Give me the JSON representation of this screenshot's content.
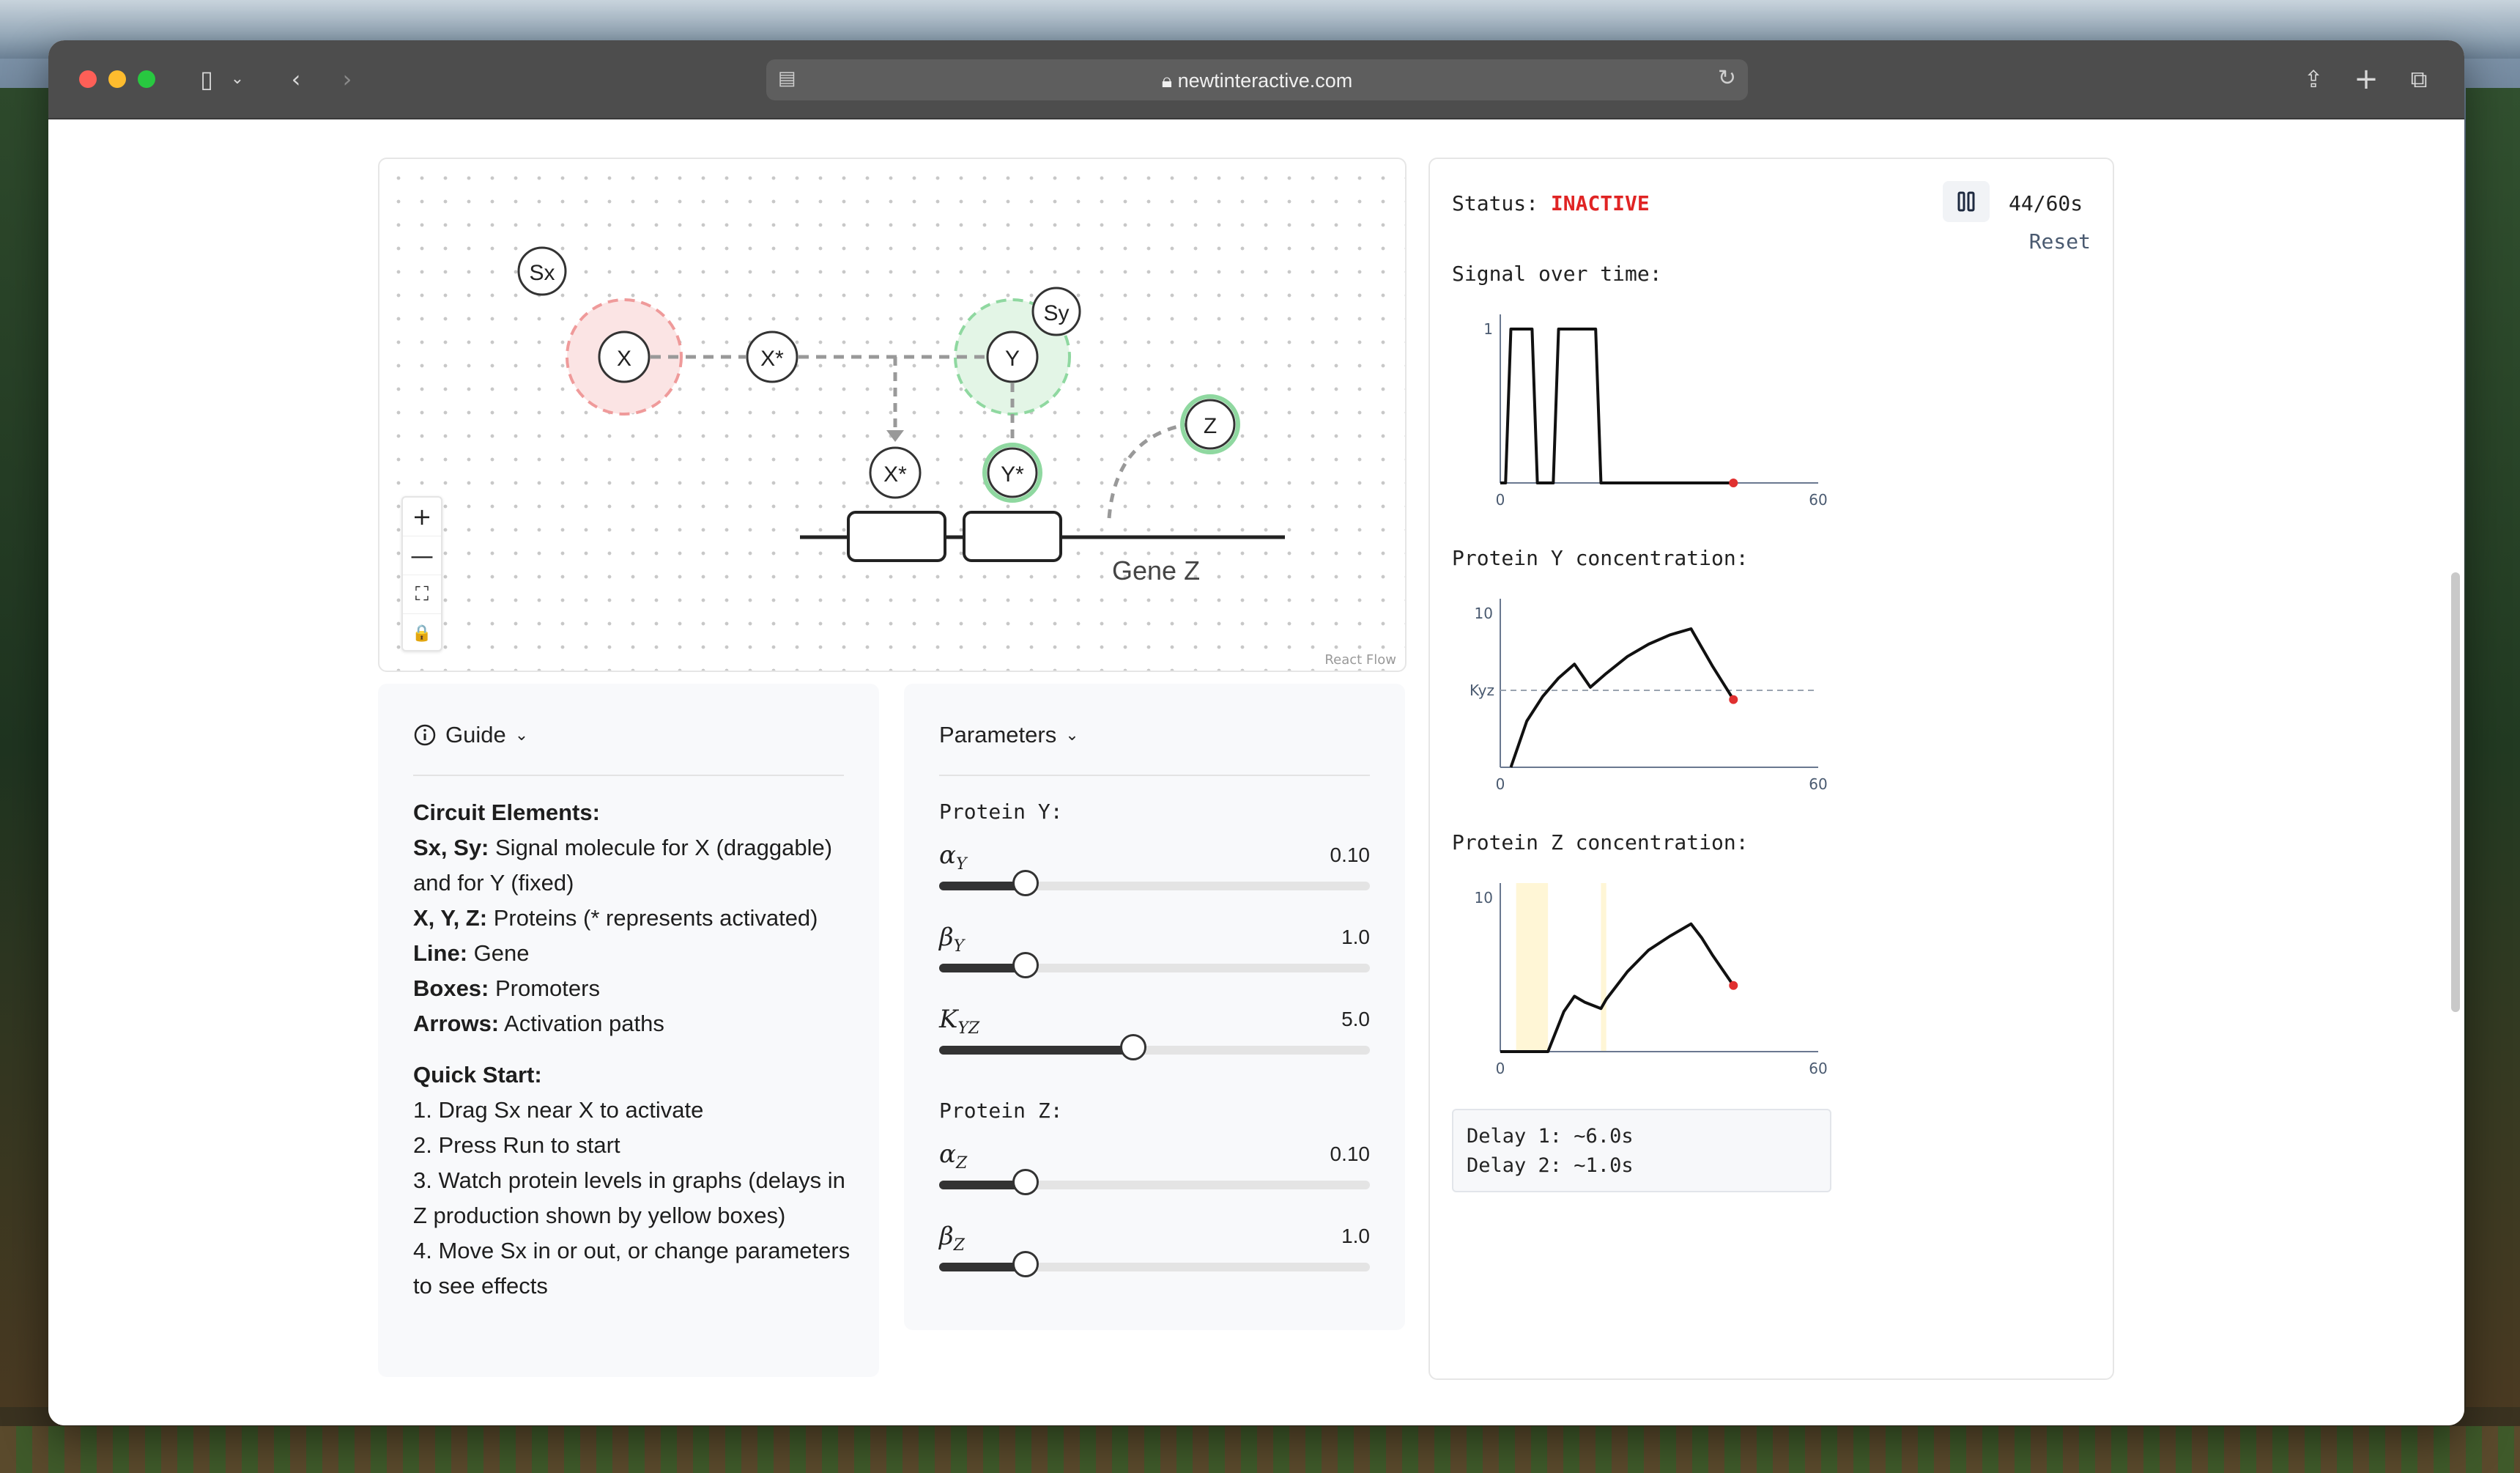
{
  "browser": {
    "url": "newtinteractive.com"
  },
  "flow": {
    "attribution": "React Flow",
    "nodes": {
      "sx": "Sx",
      "sy": "Sy",
      "x": "X",
      "x_star_top": "X*",
      "y": "Y",
      "x_star_bottom": "X*",
      "y_star": "Y*",
      "z": "Z"
    },
    "gene_label": "Gene Z",
    "controls": {
      "zoom_in": "+",
      "zoom_out": "—",
      "fit": "⛶",
      "lock": "🔒"
    }
  },
  "guide": {
    "title": "Guide",
    "circuit_heading": "Circuit Elements:",
    "items": [
      {
        "term": "Sx, Sy:",
        "text": " Signal molecule for X (draggable) and for Y (fixed)"
      },
      {
        "term": "X, Y, Z:",
        "text": " Proteins (* represents activated)"
      },
      {
        "term": "Line:",
        "text": " Gene"
      },
      {
        "term": "Boxes:",
        "text": " Promoters"
      },
      {
        "term": "Arrows:",
        "text": " Activation paths"
      }
    ],
    "quick_heading": "Quick Start:",
    "steps": [
      "1. Drag Sx near X to activate",
      "2. Press Run to start",
      "3. Watch protein levels in graphs (delays in Z production shown by yellow boxes)",
      "4. Move Sx in or out, or change parameters to see effects"
    ]
  },
  "parameters": {
    "title": "Parameters",
    "protein_y_label": "Protein Y:",
    "protein_z_label": "Protein Z:",
    "alpha_y": {
      "symbol": "αY",
      "value_text": "0.10",
      "fraction": 0.2
    },
    "beta_y": {
      "symbol": "βY",
      "value_text": "1.0",
      "fraction": 0.2
    },
    "k_yz": {
      "symbol": "KYZ",
      "value_text": "5.0",
      "fraction": 0.45
    },
    "alpha_z": {
      "symbol": "αZ",
      "value_text": "0.10",
      "fraction": 0.2
    },
    "beta_z": {
      "symbol": "βZ",
      "value_text": "1.0",
      "fraction": 0.2
    }
  },
  "status": {
    "label": "Status:",
    "value": "INACTIVE",
    "timer": "44/60s",
    "reset_label": "Reset",
    "status_color": "#e02424"
  },
  "graphs": {
    "signal_title": "Signal over time:",
    "protein_y_title": "Protein Y concentration:",
    "protein_z_title": "Protein Z concentration:",
    "delay_1": "Delay 1: ~6.0s",
    "delay_2": "Delay 2: ~1.0s"
  },
  "chart_data": [
    {
      "type": "line",
      "title": "Signal over time:",
      "xlim": [
        0,
        60
      ],
      "ylim": [
        0,
        1
      ],
      "x_ticks": [
        "0",
        "60"
      ],
      "y_ticks": [
        "1"
      ],
      "series": [
        {
          "x": [
            0,
            1,
            2,
            6,
            7,
            10,
            11,
            18,
            19,
            40,
            44
          ],
          "y": [
            0,
            0,
            1,
            1,
            0,
            0,
            1,
            1,
            0,
            0,
            0
          ]
        }
      ],
      "current_x": 44
    },
    {
      "type": "line",
      "title": "Protein Y concentration:",
      "xlim": [
        0,
        60
      ],
      "ylim": [
        0,
        10
      ],
      "x_ticks": [
        "0",
        "60"
      ],
      "y_ticks": [
        "10"
      ],
      "reference_line": {
        "label": "Kyz",
        "y": 5
      },
      "series": [
        {
          "x": [
            2,
            5,
            8,
            11,
            14,
            17,
            20,
            24,
            28,
            32,
            36,
            38,
            40,
            42,
            44
          ],
          "y": [
            0,
            3,
            4.6,
            5.8,
            6.7,
            5.2,
            6.1,
            7.2,
            8.0,
            8.6,
            9.0,
            7.8,
            6.6,
            5.5,
            4.4
          ]
        }
      ],
      "current_x": 44
    },
    {
      "type": "line",
      "title": "Protein Z concentration:",
      "xlim": [
        0,
        60
      ],
      "ylim": [
        0,
        10
      ],
      "x_ticks": [
        "0",
        "60"
      ],
      "y_ticks": [
        "10"
      ],
      "delay_regions": [
        [
          3,
          9
        ],
        [
          19,
          20
        ]
      ],
      "series": [
        {
          "x": [
            0,
            9,
            12,
            14,
            16,
            19,
            20,
            24,
            28,
            32,
            36,
            38,
            40,
            42,
            44
          ],
          "y": [
            0,
            0,
            2.6,
            3.6,
            3.2,
            2.8,
            3.4,
            5.2,
            6.6,
            7.5,
            8.3,
            7.4,
            6.3,
            5.3,
            4.3
          ]
        }
      ],
      "current_x": 44
    }
  ]
}
